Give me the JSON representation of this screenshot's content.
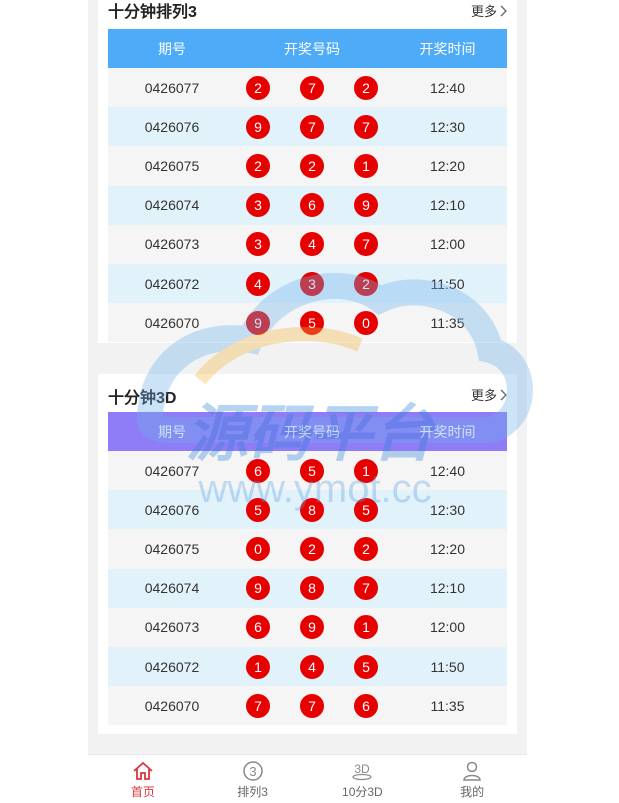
{
  "sections": [
    {
      "title": "十分钟排列3",
      "more_label": "更多",
      "columns": [
        "期号",
        "开奖号码",
        "开奖时间"
      ],
      "rows": [
        {
          "issue": "0426077",
          "nums": [
            "2",
            "7",
            "2"
          ],
          "time": "12:40"
        },
        {
          "issue": "0426076",
          "nums": [
            "9",
            "7",
            "7"
          ],
          "time": "12:30"
        },
        {
          "issue": "0426075",
          "nums": [
            "2",
            "2",
            "1"
          ],
          "time": "12:20"
        },
        {
          "issue": "0426074",
          "nums": [
            "3",
            "6",
            "9"
          ],
          "time": "12:10"
        },
        {
          "issue": "0426073",
          "nums": [
            "3",
            "4",
            "7"
          ],
          "time": "12:00"
        },
        {
          "issue": "0426072",
          "nums": [
            "4",
            "3",
            "2"
          ],
          "time": "11:50"
        },
        {
          "issue": "0426070",
          "nums": [
            "9",
            "5",
            "0"
          ],
          "time": "11:35"
        }
      ]
    },
    {
      "title": "十分钟3D",
      "more_label": "更多",
      "columns": [
        "期号",
        "开奖号码",
        "开奖时间"
      ],
      "rows": [
        {
          "issue": "0426077",
          "nums": [
            "6",
            "5",
            "1"
          ],
          "time": "12:40"
        },
        {
          "issue": "0426076",
          "nums": [
            "5",
            "8",
            "5"
          ],
          "time": "12:30"
        },
        {
          "issue": "0426075",
          "nums": [
            "0",
            "2",
            "2"
          ],
          "time": "12:20"
        },
        {
          "issue": "0426074",
          "nums": [
            "9",
            "8",
            "7"
          ],
          "time": "12:10"
        },
        {
          "issue": "0426073",
          "nums": [
            "6",
            "9",
            "1"
          ],
          "time": "12:00"
        },
        {
          "issue": "0426072",
          "nums": [
            "1",
            "4",
            "5"
          ],
          "time": "11:50"
        },
        {
          "issue": "0426070",
          "nums": [
            "7",
            "7",
            "6"
          ],
          "time": "11:35"
        }
      ]
    }
  ],
  "watermark": {
    "title": "源码平台",
    "url": "www.ymot.cc"
  },
  "tabbar": [
    {
      "label": "首页",
      "icon": "home-icon",
      "active": true
    },
    {
      "label": "排列3",
      "icon": "circle-three-icon",
      "active": false
    },
    {
      "label": "10分3D",
      "icon": "3d-icon",
      "active": false
    },
    {
      "label": "我的",
      "icon": "user-icon",
      "active": false
    }
  ],
  "colors": {
    "header_blue": "#4dabf7",
    "header_purple": "#8f7cf7",
    "ball_red": "#e60000",
    "active_tab": "#d9363e"
  }
}
